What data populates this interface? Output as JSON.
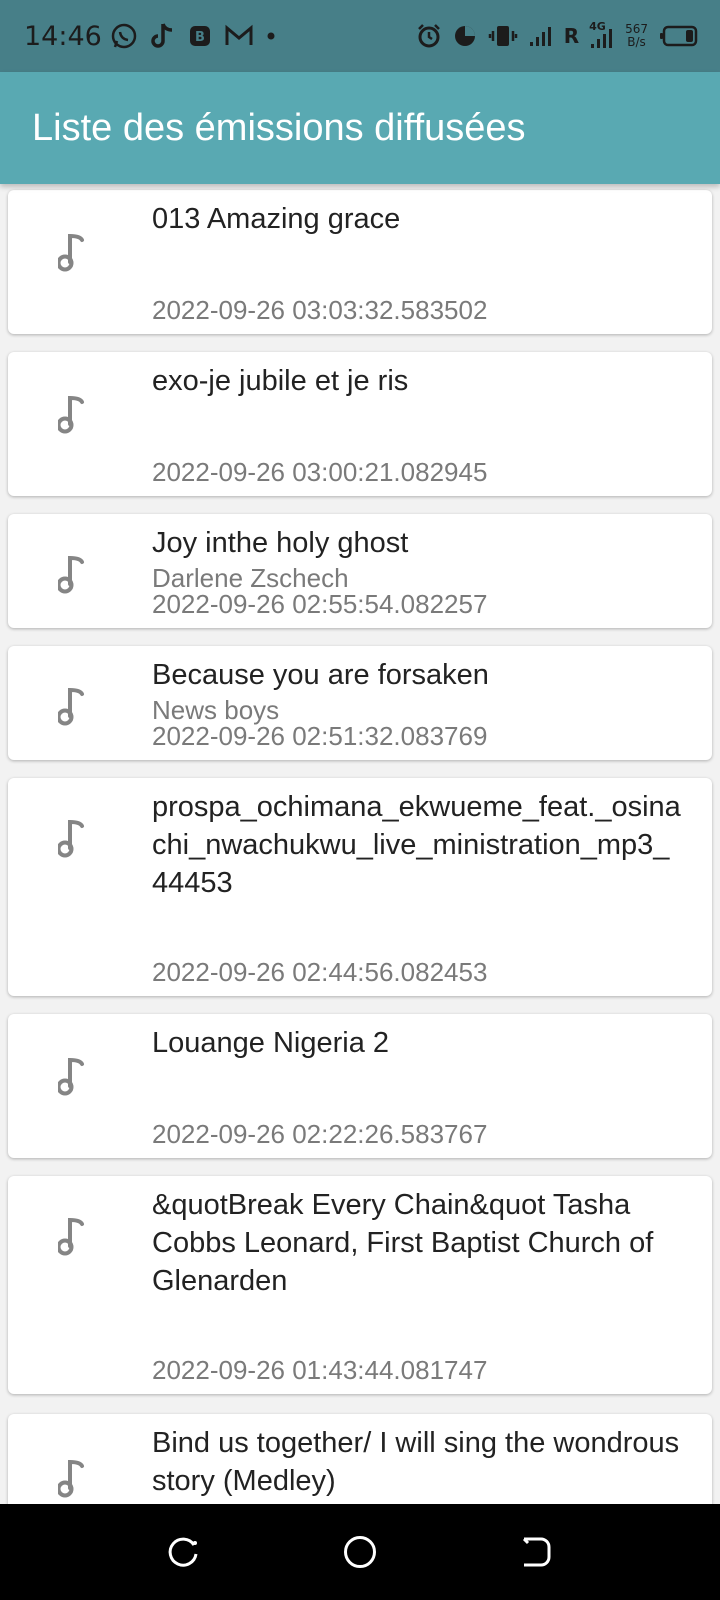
{
  "status_bar": {
    "time": "14:46",
    "signal_letter": "R",
    "network_type": "4G",
    "net_speed_value": "567",
    "net_speed_unit": "B/s",
    "icons_left": [
      "whatsapp-icon",
      "tiktok-icon",
      "app-icon",
      "gmail-icon",
      "dot-icon"
    ],
    "icons_right": [
      "alarm-icon",
      "data-saver-icon",
      "vibrate-icon",
      "signal-icon",
      "signal-4g-icon",
      "battery-icon"
    ]
  },
  "app_bar": {
    "title": "Liste des émissions diffusées"
  },
  "colors": {
    "app_bar": "#59a9b2",
    "status_bar": "#477f88",
    "icon": "#858585"
  },
  "broadcasts": [
    {
      "title": "013 Amazing grace",
      "subtitle": "",
      "date": "2022-09-26 03:03:32.583502"
    },
    {
      "title": "exo-je jubile et je ris",
      "subtitle": "",
      "date": "2022-09-26 03:00:21.082945"
    },
    {
      "title": "Joy inthe holy ghost",
      "subtitle": "Darlene Zschech",
      "date": "2022-09-26 02:55:54.082257"
    },
    {
      "title": "Because you are forsaken",
      "subtitle": "News boys",
      "date": "2022-09-26 02:51:32.083769"
    },
    {
      "title": "prospa_ochimana_ekwueme_feat._osinachi_nwachukwu_live_ministration_mp3_44453",
      "subtitle": "",
      "date": "2022-09-26 02:44:56.082453"
    },
    {
      "title": "Louange Nigeria 2",
      "subtitle": "",
      "date": "2022-09-26 02:22:26.583767"
    },
    {
      "title": "&quotBreak Every Chain&quot Tasha Cobbs Leonard, First Baptist Church of Glenarden",
      "subtitle": "",
      "date": "2022-09-26 01:43:44.081747"
    },
    {
      "title": "Bind us together/ I will sing the wondrous story (Medley)",
      "subtitle": "",
      "date": ""
    }
  ],
  "nav_bar": {
    "buttons": [
      "recents-button",
      "home-button",
      "back-button"
    ]
  }
}
